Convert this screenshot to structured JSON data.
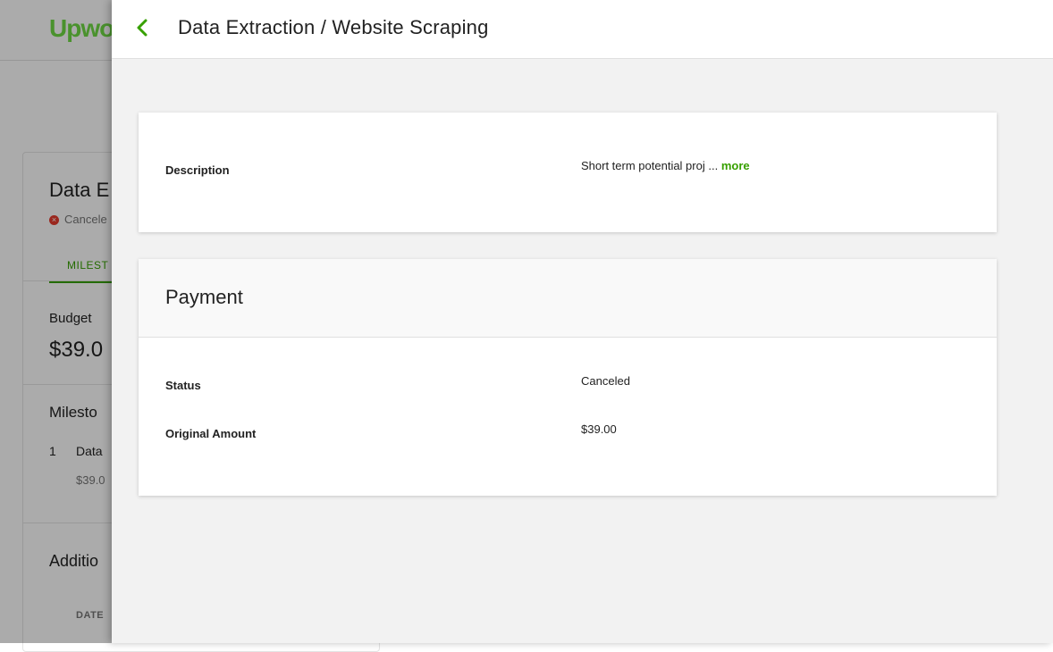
{
  "background": {
    "logo_up": "Up",
    "logo_rest": "wo",
    "title": "Data E",
    "status": "Cancele",
    "tab_label": "MILEST",
    "budget_label": "Budget",
    "budget_value": "$39.0",
    "milestones_heading": "Milesto",
    "milestone_number": "1",
    "milestone_name": "Data",
    "milestone_amount": "$39.0",
    "additional_heading": "Additio",
    "date_column": "DATE"
  },
  "panel": {
    "title": "Data Extraction / Website Scraping",
    "description": {
      "label": "Description",
      "value": "Short term potential proj ...",
      "more_link": "more"
    },
    "payment": {
      "heading": "Payment",
      "status_label": "Status",
      "status_value": "Canceled",
      "amount_label": "Original Amount",
      "amount_value": "$39.00"
    }
  },
  "colors": {
    "accent": "#37a000",
    "brand": "#6fda44",
    "error": "#e63b2e"
  }
}
